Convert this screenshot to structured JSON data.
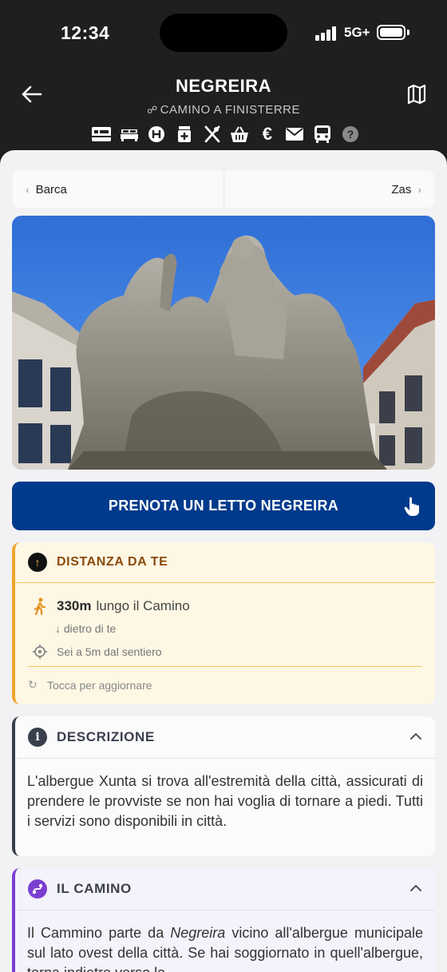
{
  "status_bar": {
    "time": "12:34",
    "network": "5G+"
  },
  "header": {
    "title": "NEGREIRA",
    "subtitle": "CAMINO A FINISTERRE",
    "service_icons": [
      "albergue-icon",
      "bed-icon",
      "hotel-icon",
      "pharmacy-icon",
      "restaurant-icon",
      "shop-basket-icon",
      "atm-euro-icon",
      "mail-icon",
      "bus-icon",
      "help-icon"
    ]
  },
  "nav": {
    "prev_label": "Barca",
    "next_label": "Zas"
  },
  "booking": {
    "button_label": "PRENOTA UN LETTO NEGREIRA"
  },
  "distance": {
    "title": "DISTANZA DA TE",
    "value": "330m",
    "along_text": "lungo il Camino",
    "behind_text": "dietro di te",
    "offset_text": "Sei a 5m dal sentiero",
    "refresh_text": "Tocca per aggiornare",
    "accent_color": "#f0a428"
  },
  "description": {
    "title": "DESCRIZIONE",
    "text": "L'albergue Xunta si trova all'estremità della città, assicurati di prendere le provviste se non hai voglia di tornare a piedi.  Tutti i servizi sono disponibili in città."
  },
  "camino": {
    "title": "IL CAMINO",
    "text_before": "Il Cammino parte da ",
    "text_italic": "Negreira",
    "text_after": " vicino all'albergue municipale sul lato ovest della città. Se hai soggiornato in quell'albergue, torna indietro verso la",
    "accent_color": "#7b3fd0"
  }
}
